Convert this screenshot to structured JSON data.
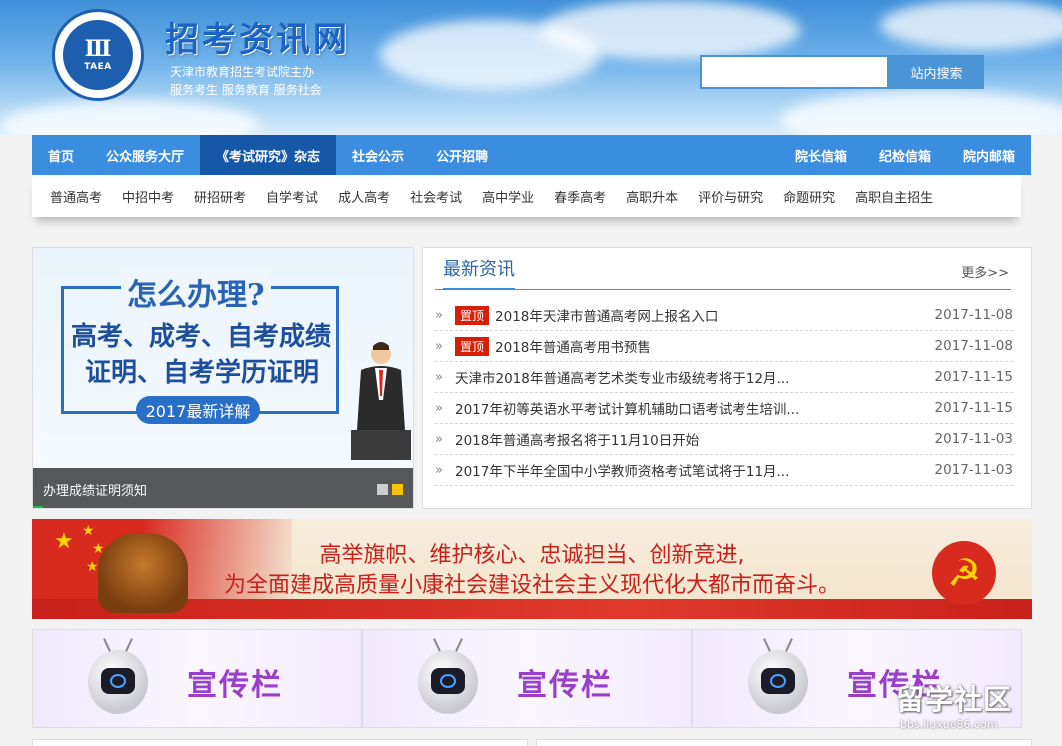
{
  "header": {
    "site_title": "招考资讯网",
    "sub_line1": "天津市教育招生考试院主办",
    "sub_line2": "服务考生 服务教育 服务社会",
    "logo_text": "TAEA",
    "search": {
      "placeholder": "",
      "button_label": "站内搜索"
    }
  },
  "main_nav": {
    "items": [
      "首页",
      "公众服务大厅",
      "《考试研究》杂志",
      "社会公示",
      "公开招聘"
    ],
    "active_index": 2,
    "right_items": [
      "院长信箱",
      "纪检信箱",
      "院内邮箱"
    ]
  },
  "sub_nav": {
    "items": [
      "普通高考",
      "中招中考",
      "研招研考",
      "自学考试",
      "成人高考",
      "社会考试",
      "高中学业",
      "春季高考",
      "高职升本",
      "评价与研究",
      "命题研究",
      "高职自主招生"
    ]
  },
  "slider": {
    "headline": "怎么办理?",
    "line1": "高考、成考、自考成绩",
    "line2": "证明、自考学历证明",
    "pill": "2017最新详解",
    "caption": "办理成绩证明须知",
    "dots": 2,
    "active_dot": 1
  },
  "news": {
    "title": "最新资讯",
    "more": "更多>>",
    "items": [
      {
        "badge": "置顶",
        "title": "2018年天津市普通高考网上报名入口",
        "date": "2017-11-08"
      },
      {
        "badge": "置顶",
        "title": "2018年普通高考用书预售",
        "date": "2017-11-08"
      },
      {
        "badge": "",
        "title": "天津市2018年普通高考艺术类专业市级统考将于12月...",
        "date": "2017-11-15"
      },
      {
        "badge": "",
        "title": "2017年初等英语水平考试计算机辅助口语考试考生培训...",
        "date": "2017-11-15"
      },
      {
        "badge": "",
        "title": "2018年普通高考报名将于11月10日开始",
        "date": "2017-11-03"
      },
      {
        "badge": "",
        "title": "2017年下半年全国中小学教师资格考试笔试将于11月...",
        "date": "2017-11-03"
      }
    ]
  },
  "banner": {
    "line1": "高举旗帜、维护核心、忠诚担当、创新竞进,",
    "line2": "为全面建成高质量小康社会建设社会主义现代化大都市而奋斗。"
  },
  "promo": {
    "label": "宣传栏"
  },
  "watermark": {
    "big": "留学社区",
    "small": "bbs.liuxue86.com"
  },
  "colors": {
    "nav_blue": "#3b8de0",
    "nav_active": "#1757a7",
    "badge_red": "#d81e06",
    "promo_purple": "#9a3fc9"
  }
}
